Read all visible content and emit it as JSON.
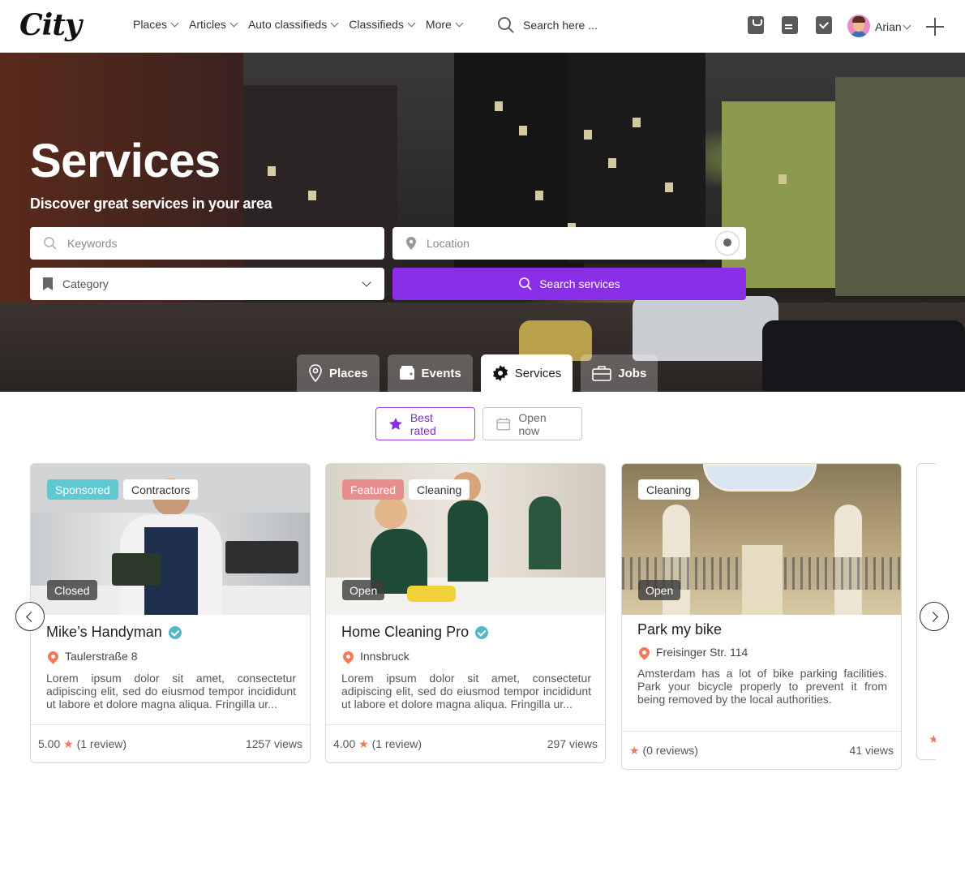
{
  "header": {
    "logo": "City",
    "nav": [
      "Places",
      "Articles",
      "Auto classifieds",
      "Classifieds",
      "More"
    ],
    "search_placeholder": "Search here ...",
    "user_name": "Arian"
  },
  "hero": {
    "title": "Services",
    "subtitle": "Discover great services in your area",
    "keywords_placeholder": "Keywords",
    "location_placeholder": "Location",
    "category_placeholder": "Category",
    "search_button": "Search services",
    "tabs": [
      "Places",
      "Events",
      "Services",
      "Jobs"
    ],
    "active_tab": "Services"
  },
  "filters": {
    "best_rated": "Best rated",
    "open_now": "Open now"
  },
  "cards": [
    {
      "badges": [
        "Sponsored",
        "Contractors"
      ],
      "status": "Closed",
      "title": "Mike’s Handyman",
      "address": "Taulerstraße 8",
      "description": "Lorem ipsum dolor sit amet, consectetur adipiscing elit, sed do eiusmod tempor incididunt ut labore et dolore magna aliqua. Fringilla ur...",
      "rating": "5.00",
      "reviews": "(1 review)",
      "views": "1257 views"
    },
    {
      "badges": [
        "Featured",
        "Cleaning"
      ],
      "status": "Open",
      "title": "Home Cleaning Pro",
      "address": "Innsbruck",
      "description": "Lorem ipsum dolor sit amet, consectetur adipiscing elit, sed do eiusmod tempor incididunt ut labore et dolore magna aliqua. Fringilla ur...",
      "rating": "4.00",
      "reviews": "(1 review)",
      "views": "297 views"
    },
    {
      "badges": [
        "Cleaning"
      ],
      "status": "Open",
      "title": "Park my bike",
      "address": "Freisinger Str. 114",
      "description": "Amsterdam has a lot of bike parking facilities. Park your bicycle properly to prevent it from being removed by the local authorities.",
      "rating": "",
      "reviews": "(0 reviews)",
      "views": "41 views"
    }
  ],
  "colors": {
    "accent": "#8b2ee8",
    "sponsored": "#5fc8d3",
    "featured": "#e98e8e",
    "star": "#ef7a5a"
  }
}
